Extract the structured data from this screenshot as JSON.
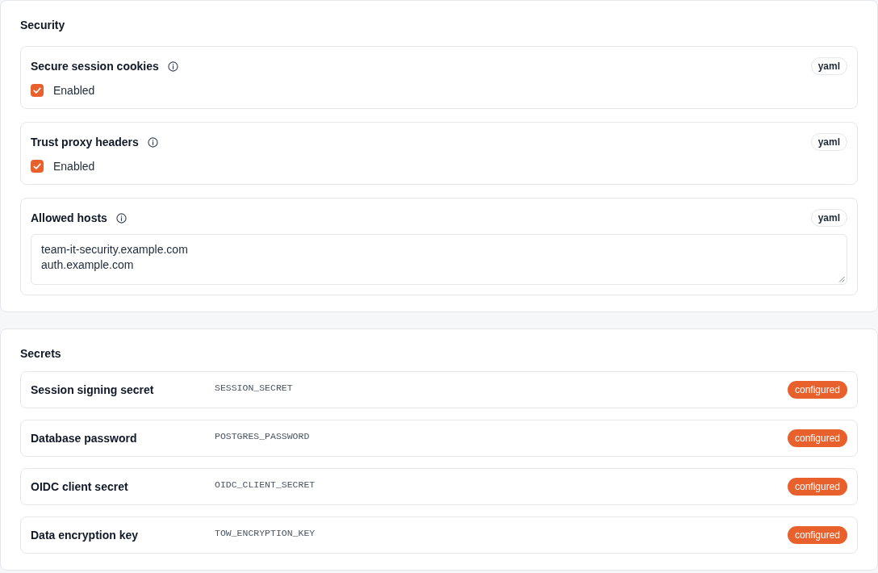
{
  "security": {
    "title": "Security",
    "fields": [
      {
        "kind": "checkbox",
        "label": "Secure session cookies",
        "format": "yaml",
        "option": "Enabled",
        "checked": true
      },
      {
        "kind": "checkbox",
        "label": "Trust proxy headers",
        "format": "yaml",
        "option": "Enabled",
        "checked": true
      },
      {
        "kind": "textarea",
        "label": "Allowed hosts",
        "format": "yaml",
        "value": "team-it-security.example.com\nauth.example.com"
      }
    ]
  },
  "secrets": {
    "title": "Secrets",
    "items": [
      {
        "label": "Session signing secret",
        "env": "SESSION_SECRET",
        "status": "configured"
      },
      {
        "label": "Database password",
        "env": "POSTGRES_PASSWORD",
        "status": "configured"
      },
      {
        "label": "OIDC client secret",
        "env": "OIDC_CLIENT_SECRET",
        "status": "configured"
      },
      {
        "label": "Data encryption key",
        "env": "TOW_ENCRYPTION_KEY",
        "status": "configured"
      }
    ]
  }
}
